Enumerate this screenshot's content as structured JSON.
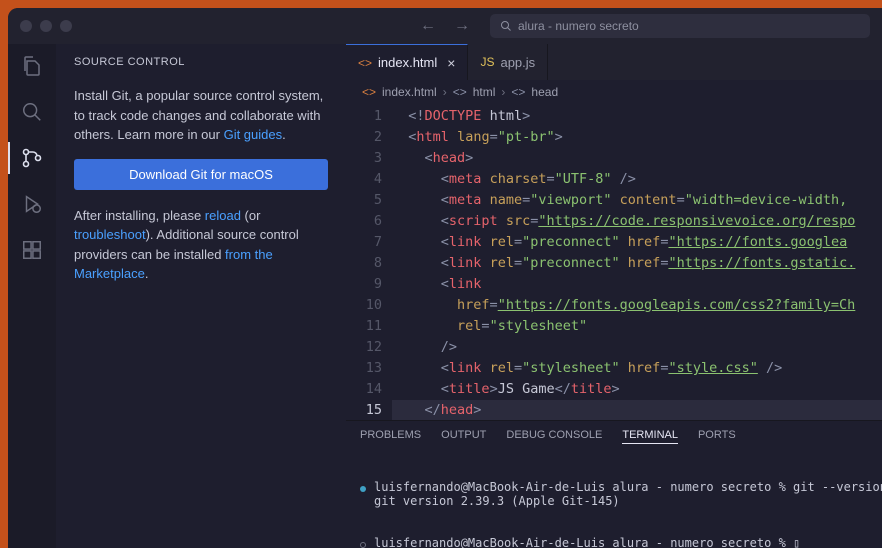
{
  "titlebar": {
    "search_text": "alura - numero secreto"
  },
  "sidebar": {
    "title": "SOURCE CONTROL",
    "intro_pre": "Install Git, a popular source control system, to track code changes and collaborate with others. Learn more in our ",
    "intro_link": "Git guides",
    "download_label": "Download Git for macOS",
    "after_pre": "After installing, please ",
    "after_link1": "reload",
    "after_mid1": " (or ",
    "after_link2": "troubleshoot",
    "after_mid2": "). Additional source control providers can be installed ",
    "after_link3": "from the Marketplace"
  },
  "tabs": [
    {
      "icon": "<>",
      "label": "index.html",
      "active": true,
      "closable": true,
      "iconClass": "orange"
    },
    {
      "icon": "JS",
      "label": "app.js",
      "active": false,
      "closable": false,
      "iconClass": "yellow"
    }
  ],
  "breadcrumbs": {
    "a": "index.html",
    "b": "html",
    "c": "head"
  },
  "code": {
    "lines": [
      {
        "n": "1",
        "indent": 1,
        "frags": [
          {
            "c": "t-punc",
            "t": "<!"
          },
          {
            "c": "t-doctype",
            "t": "DOCTYPE"
          },
          {
            "c": "t-text",
            "t": " html"
          },
          {
            "c": "t-punc",
            "t": ">"
          }
        ]
      },
      {
        "n": "2",
        "indent": 1,
        "frags": [
          {
            "c": "t-punc",
            "t": "<"
          },
          {
            "c": "t-tag",
            "t": "html"
          },
          {
            "c": "t-text",
            "t": " "
          },
          {
            "c": "t-attr",
            "t": "lang"
          },
          {
            "c": "t-punc",
            "t": "="
          },
          {
            "c": "t-str",
            "t": "\"pt-br\""
          },
          {
            "c": "t-punc",
            "t": ">"
          }
        ]
      },
      {
        "n": "3",
        "indent": 2,
        "frags": [
          {
            "c": "t-punc",
            "t": "<"
          },
          {
            "c": "t-tag",
            "t": "head"
          },
          {
            "c": "t-punc",
            "t": ">"
          }
        ]
      },
      {
        "n": "4",
        "indent": 3,
        "frags": [
          {
            "c": "t-punc",
            "t": "<"
          },
          {
            "c": "t-tag",
            "t": "meta"
          },
          {
            "c": "t-text",
            "t": " "
          },
          {
            "c": "t-attr",
            "t": "charset"
          },
          {
            "c": "t-punc",
            "t": "="
          },
          {
            "c": "t-str",
            "t": "\"UTF-8\""
          },
          {
            "c": "t-text",
            "t": " "
          },
          {
            "c": "t-punc",
            "t": "/>"
          }
        ]
      },
      {
        "n": "5",
        "indent": 3,
        "frags": [
          {
            "c": "t-punc",
            "t": "<"
          },
          {
            "c": "t-tag",
            "t": "meta"
          },
          {
            "c": "t-text",
            "t": " "
          },
          {
            "c": "t-attr",
            "t": "name"
          },
          {
            "c": "t-punc",
            "t": "="
          },
          {
            "c": "t-str",
            "t": "\"viewport\""
          },
          {
            "c": "t-text",
            "t": " "
          },
          {
            "c": "t-attr",
            "t": "content"
          },
          {
            "c": "t-punc",
            "t": "="
          },
          {
            "c": "t-str",
            "t": "\"width=device-width, "
          }
        ]
      },
      {
        "n": "6",
        "indent": 3,
        "frags": [
          {
            "c": "t-punc",
            "t": "<"
          },
          {
            "c": "t-tag",
            "t": "script"
          },
          {
            "c": "t-text",
            "t": " "
          },
          {
            "c": "t-attr",
            "t": "src"
          },
          {
            "c": "t-punc",
            "t": "="
          },
          {
            "c": "t-strlink",
            "t": "\"https://code.responsivevoice.org/respo"
          }
        ]
      },
      {
        "n": "7",
        "indent": 3,
        "frags": [
          {
            "c": "t-punc",
            "t": "<"
          },
          {
            "c": "t-tag",
            "t": "link"
          },
          {
            "c": "t-text",
            "t": " "
          },
          {
            "c": "t-attr",
            "t": "rel"
          },
          {
            "c": "t-punc",
            "t": "="
          },
          {
            "c": "t-str",
            "t": "\"preconnect\""
          },
          {
            "c": "t-text",
            "t": " "
          },
          {
            "c": "t-attr",
            "t": "href"
          },
          {
            "c": "t-punc",
            "t": "="
          },
          {
            "c": "t-strlink",
            "t": "\"https://fonts.googlea"
          }
        ]
      },
      {
        "n": "8",
        "indent": 3,
        "frags": [
          {
            "c": "t-punc",
            "t": "<"
          },
          {
            "c": "t-tag",
            "t": "link"
          },
          {
            "c": "t-text",
            "t": " "
          },
          {
            "c": "t-attr",
            "t": "rel"
          },
          {
            "c": "t-punc",
            "t": "="
          },
          {
            "c": "t-str",
            "t": "\"preconnect\""
          },
          {
            "c": "t-text",
            "t": " "
          },
          {
            "c": "t-attr",
            "t": "href"
          },
          {
            "c": "t-punc",
            "t": "="
          },
          {
            "c": "t-strlink",
            "t": "\"https://fonts.gstatic."
          }
        ]
      },
      {
        "n": "9",
        "indent": 3,
        "frags": [
          {
            "c": "t-punc",
            "t": "<"
          },
          {
            "c": "t-tag",
            "t": "link"
          }
        ]
      },
      {
        "n": "10",
        "indent": 4,
        "frags": [
          {
            "c": "t-attr",
            "t": "href"
          },
          {
            "c": "t-punc",
            "t": "="
          },
          {
            "c": "t-strlink",
            "t": "\"https://fonts.googleapis.com/css2?family=Ch"
          }
        ]
      },
      {
        "n": "11",
        "indent": 4,
        "frags": [
          {
            "c": "t-attr",
            "t": "rel"
          },
          {
            "c": "t-punc",
            "t": "="
          },
          {
            "c": "t-str",
            "t": "\"stylesheet\""
          }
        ]
      },
      {
        "n": "12",
        "indent": 3,
        "frags": [
          {
            "c": "t-punc",
            "t": "/>"
          }
        ]
      },
      {
        "n": "13",
        "indent": 3,
        "frags": [
          {
            "c": "t-punc",
            "t": "<"
          },
          {
            "c": "t-tag",
            "t": "link"
          },
          {
            "c": "t-text",
            "t": " "
          },
          {
            "c": "t-attr",
            "t": "rel"
          },
          {
            "c": "t-punc",
            "t": "="
          },
          {
            "c": "t-str",
            "t": "\"stylesheet\""
          },
          {
            "c": "t-text",
            "t": " "
          },
          {
            "c": "t-attr",
            "t": "href"
          },
          {
            "c": "t-punc",
            "t": "="
          },
          {
            "c": "t-strlink",
            "t": "\"style.css\""
          },
          {
            "c": "t-text",
            "t": " "
          },
          {
            "c": "t-punc",
            "t": "/>"
          }
        ]
      },
      {
        "n": "14",
        "indent": 3,
        "frags": [
          {
            "c": "t-punc",
            "t": "<"
          },
          {
            "c": "t-tag",
            "t": "title"
          },
          {
            "c": "t-punc",
            "t": ">"
          },
          {
            "c": "t-text",
            "t": "JS Game"
          },
          {
            "c": "t-punc",
            "t": "</"
          },
          {
            "c": "t-tag",
            "t": "title"
          },
          {
            "c": "t-punc",
            "t": ">"
          }
        ]
      },
      {
        "n": "15",
        "indent": 2,
        "cur": true,
        "frags": [
          {
            "c": "t-punc",
            "t": "</"
          },
          {
            "c": "t-tag",
            "t": "head"
          },
          {
            "c": "t-punc",
            "t": ">"
          }
        ]
      }
    ]
  },
  "panel": {
    "tabs": {
      "problems": "PROBLEMS",
      "output": "OUTPUT",
      "debug": "DEBUG CONSOLE",
      "terminal": "TERMINAL",
      "ports": "PORTS"
    },
    "line1": "luisfernando@MacBook-Air-de-Luis alura - numero secreto % git --version",
    "line2": "git version 2.39.3 (Apple Git-145)",
    "line3": "luisfernando@MacBook-Air-de-Luis alura - numero secreto % "
  }
}
